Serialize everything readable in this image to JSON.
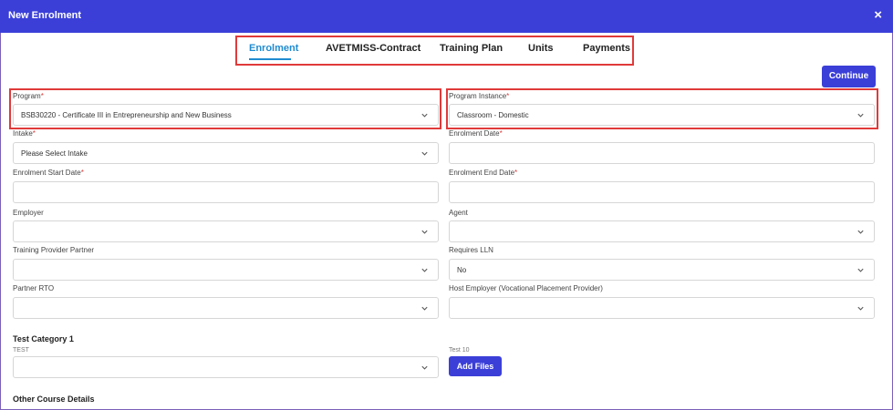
{
  "dialog": {
    "title": "New Enrolment",
    "close_icon": "×"
  },
  "tabs": [
    {
      "label": "Enrolment",
      "active": true
    },
    {
      "label": "AVETMISS-Contract"
    },
    {
      "label": "Training Plan"
    },
    {
      "label": "Units"
    },
    {
      "label": "Payments"
    }
  ],
  "buttons": {
    "continue": "Continue",
    "add_files": "Add Files"
  },
  "fields": {
    "program": {
      "label": "Program",
      "value": "BSB30220 - Certificate III in Entrepreneurship and New Business"
    },
    "program_instance": {
      "label": "Program Instance",
      "value": "Classroom - Domestic"
    },
    "intake": {
      "label": "Intake",
      "value": "Please Select Intake"
    },
    "enrolment_date": {
      "label": "Enrolment Date",
      "value": ""
    },
    "enrolment_start_date": {
      "label": "Enrolment Start Date",
      "value": ""
    },
    "enrolment_end_date": {
      "label": "Enrolment End Date",
      "value": ""
    },
    "employer": {
      "label": "Employer",
      "value": ""
    },
    "agent": {
      "label": "Agent",
      "value": ""
    },
    "training_provider_partner": {
      "label": "Training Provider Partner",
      "value": ""
    },
    "requires_lln": {
      "label": "Requires LLN",
      "value": "No"
    },
    "partner_rto": {
      "label": "Partner RTO",
      "value": ""
    },
    "host_employer": {
      "label": "Host Employer (Vocational Placement Provider)",
      "value": ""
    },
    "test": {
      "label": "TEST",
      "value": ""
    }
  },
  "required_marker": "*",
  "sections": {
    "test_category": "Test Category 1",
    "test10_label": "Test 10",
    "other_course_details": "Other Course Details"
  },
  "colors": {
    "header": "#3b3fd8",
    "accent": "#1f8bd0",
    "highlight": "#e03a3a"
  }
}
